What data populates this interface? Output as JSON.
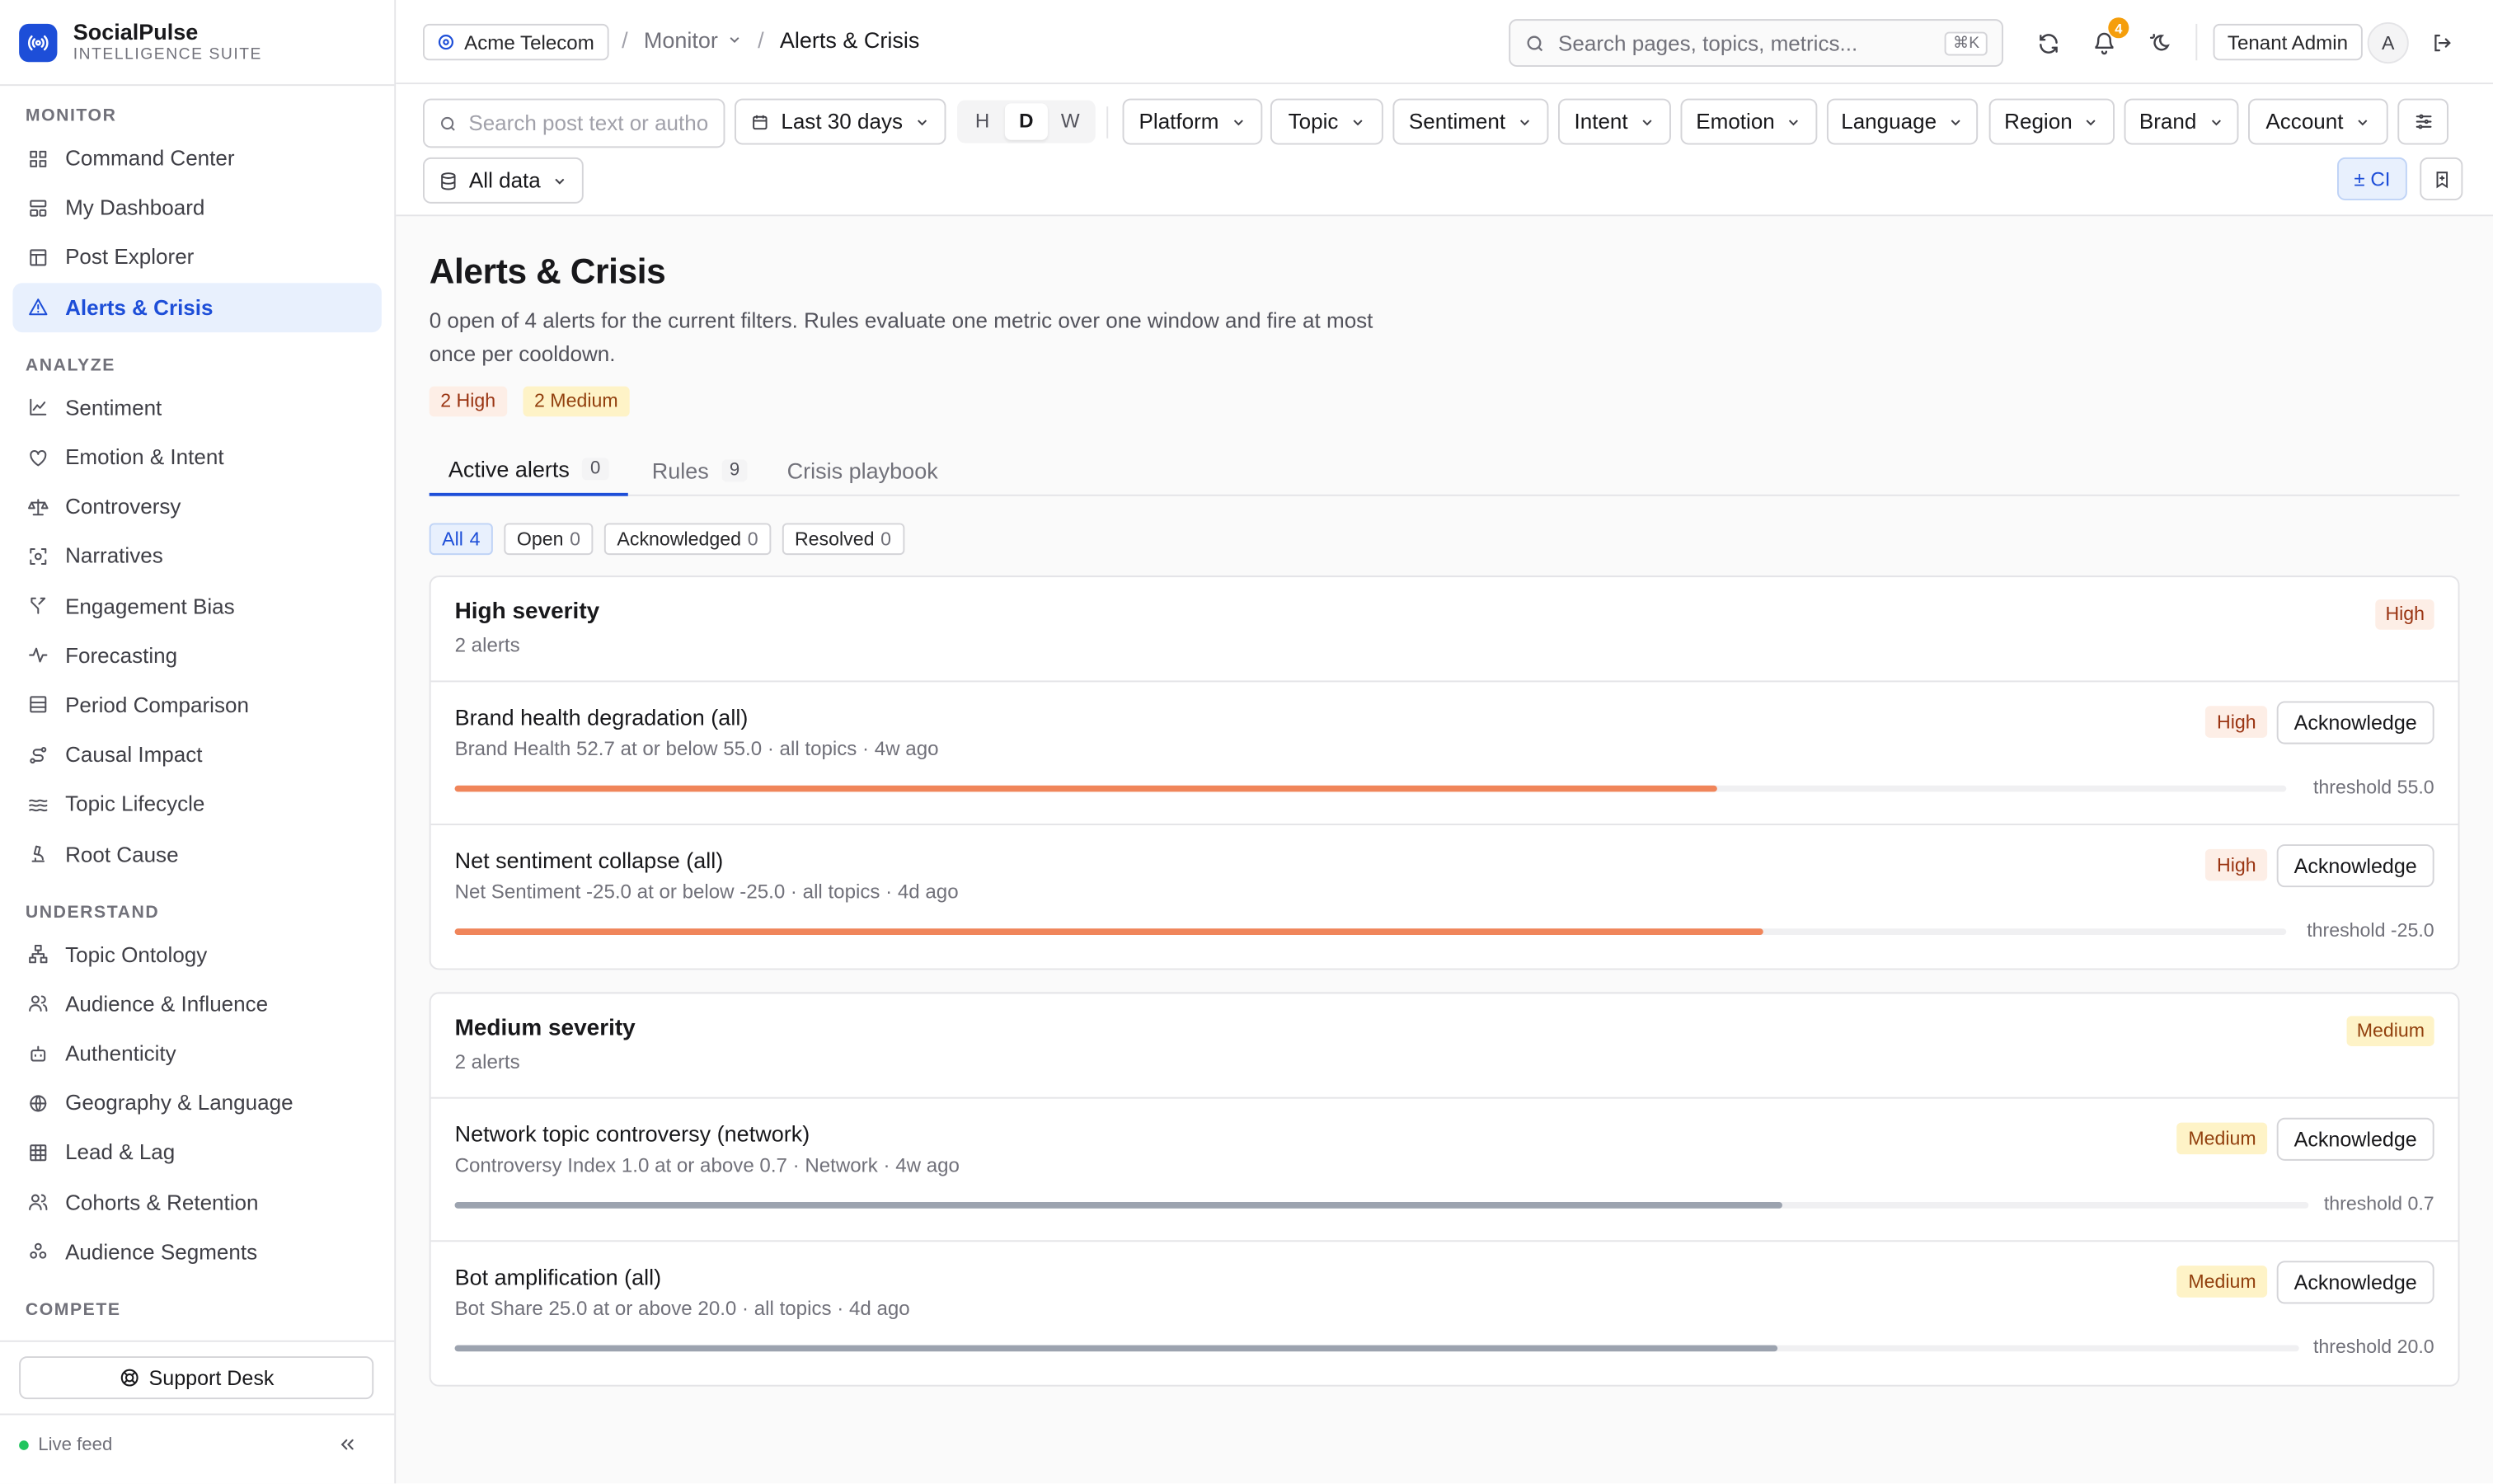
{
  "brand": {
    "name": "SocialPulse",
    "subtitle": "INTELLIGENCE SUITE"
  },
  "sidebar": {
    "sections": [
      {
        "title": "MONITOR",
        "items": [
          {
            "label": "Command Center",
            "icon": "grid-icon"
          },
          {
            "label": "My Dashboard",
            "icon": "layout-icon"
          },
          {
            "label": "Post Explorer",
            "icon": "table-icon"
          },
          {
            "label": "Alerts & Crisis",
            "icon": "warning-triangle-icon",
            "active": true
          }
        ]
      },
      {
        "title": "ANALYZE",
        "items": [
          {
            "label": "Sentiment",
            "icon": "line-chart-icon"
          },
          {
            "label": "Emotion & Intent",
            "icon": "heart-icon"
          },
          {
            "label": "Controversy",
            "icon": "scale-icon"
          },
          {
            "label": "Narratives",
            "icon": "scan-icon"
          },
          {
            "label": "Engagement Bias",
            "icon": "split-icon"
          },
          {
            "label": "Forecasting",
            "icon": "pulse-icon"
          },
          {
            "label": "Period Comparison",
            "icon": "compare-icon"
          },
          {
            "label": "Causal Impact",
            "icon": "route-icon"
          },
          {
            "label": "Topic Lifecycle",
            "icon": "waves-icon"
          },
          {
            "label": "Root Cause",
            "icon": "microscope-icon"
          }
        ]
      },
      {
        "title": "UNDERSTAND",
        "items": [
          {
            "label": "Topic Ontology",
            "icon": "hierarchy-icon"
          },
          {
            "label": "Audience & Influence",
            "icon": "users-icon"
          },
          {
            "label": "Authenticity",
            "icon": "bot-icon"
          },
          {
            "label": "Geography & Language",
            "icon": "globe-icon"
          },
          {
            "label": "Lead & Lag",
            "icon": "grid-table-icon"
          },
          {
            "label": "Cohorts & Retention",
            "icon": "users-icon"
          },
          {
            "label": "Audience Segments",
            "icon": "segments-icon"
          }
        ]
      },
      {
        "title": "COMPETE",
        "items": []
      }
    ],
    "support_label": "Support Desk",
    "live_label": "Live feed"
  },
  "topbar": {
    "tenant": "Acme Telecom",
    "crumb_section": "Monitor",
    "crumb_current": "Alerts & Crisis",
    "search_placeholder": "Search pages, topics, metrics...",
    "search_shortcut": "⌘K",
    "notification_count": "4",
    "role": "Tenant Admin",
    "avatar_initial": "A"
  },
  "filters": {
    "search_placeholder": "Search post text or author",
    "date_range": "Last 30 days",
    "granularity": [
      "H",
      "D",
      "W"
    ],
    "granularity_selected": "D",
    "dropdowns": [
      "Platform",
      "Topic",
      "Sentiment",
      "Intent",
      "Emotion",
      "Language",
      "Region",
      "Brand",
      "Account"
    ],
    "data_scope": "All data",
    "ci_label": "± CI"
  },
  "page": {
    "title": "Alerts & Crisis",
    "description": "0 open of 4 alerts for the current filters. Rules evaluate one metric over one window and fire at most once per cooldown.",
    "summary_high": "2 High",
    "summary_medium": "2 Medium",
    "tabs": [
      {
        "label": "Active alerts",
        "count": "0"
      },
      {
        "label": "Rules",
        "count": "9"
      },
      {
        "label": "Crisis playbook",
        "count": ""
      }
    ],
    "status_filters": [
      {
        "label": "All",
        "count": "4"
      },
      {
        "label": "Open",
        "count": "0"
      },
      {
        "label": "Acknowledged",
        "count": "0"
      },
      {
        "label": "Resolved",
        "count": "0"
      }
    ],
    "ack_label": "Acknowledge"
  },
  "colors": {
    "accent": "#1d4ed8",
    "high_bar": "#f0855a",
    "medium_bar": "#9ca3af",
    "high_bg": "#fdeee6",
    "medium_bg": "#fef3c7"
  },
  "groups": [
    {
      "title": "High severity",
      "count_text": "2 alerts",
      "badge": "High",
      "level": "high",
      "alerts": [
        {
          "title": "Brand health degradation (all)",
          "meta": "Brand Health 52.7 at or below 55.0 · all topics · 4w ago",
          "badge": "High",
          "threshold": "threshold 55.0",
          "progress": 0.689
        },
        {
          "title": "Net sentiment collapse (all)",
          "meta": "Net Sentiment -25.0 at or below -25.0 · all topics · 4d ago",
          "badge": "High",
          "threshold": "threshold -25.0",
          "progress": 0.714
        }
      ]
    },
    {
      "title": "Medium severity",
      "count_text": "2 alerts",
      "badge": "Medium",
      "level": "medium",
      "alerts": [
        {
          "title": "Network topic controversy (network)",
          "meta": "Controversy Index 1.0 at or above 0.7 · Network · 4w ago",
          "badge": "Medium",
          "threshold": "threshold 0.7",
          "progress": 0.716
        },
        {
          "title": "Bot amplification (all)",
          "meta": "Bot Share 25.0 at or above 20.0 · all topics · 4d ago",
          "badge": "Medium",
          "threshold": "threshold 20.0",
          "progress": 0.717
        }
      ]
    }
  ]
}
